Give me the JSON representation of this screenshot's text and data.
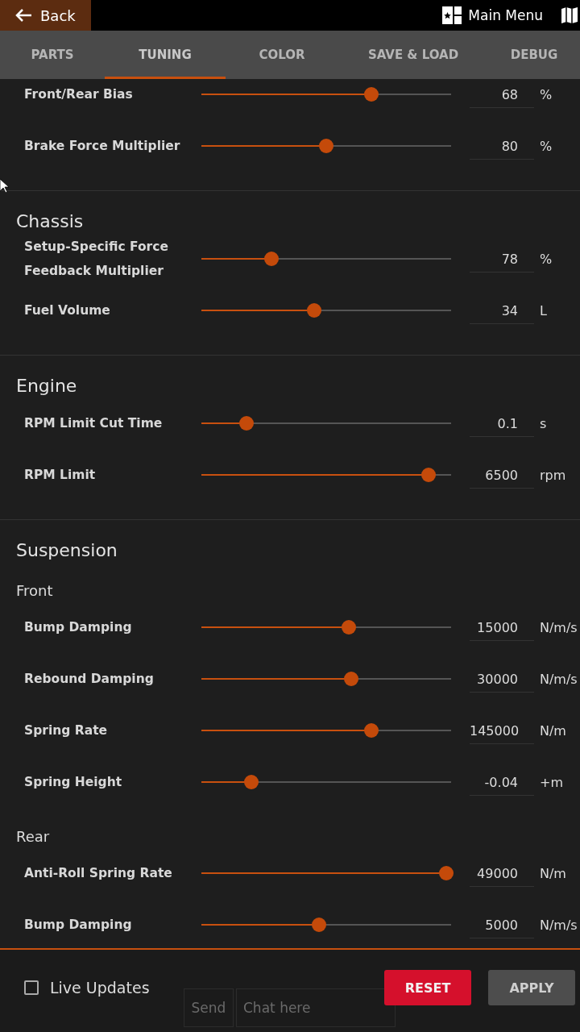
{
  "top_bar": {
    "back_label": "Back",
    "main_menu_label": "Main Menu"
  },
  "tabs": [
    {
      "label": "PARTS",
      "selected": false
    },
    {
      "label": "TUNING",
      "selected": true
    },
    {
      "label": "COLOR",
      "selected": false
    },
    {
      "label": "SAVE & LOAD",
      "selected": false
    },
    {
      "label": "DEBUG",
      "selected": false
    }
  ],
  "sections": [
    {
      "groups": [
        {
          "rows": [
            {
              "label": "Front/Rear Bias",
              "level": 0.68,
              "value": "68",
              "unit": "%"
            },
            {
              "label": "Brake Force Multiplier",
              "level": 0.5,
              "value": "80",
              "unit": "%"
            }
          ]
        }
      ]
    },
    {
      "title": "Chassis",
      "groups": [
        {
          "rows": [
            {
              "label": "Setup-Specific Force Feedback Multiplier",
              "level": 0.28,
              "value": "78",
              "unit": "%"
            },
            {
              "label": "Fuel Volume",
              "level": 0.45,
              "value": "34",
              "unit": "L"
            }
          ]
        }
      ]
    },
    {
      "title": "Engine",
      "groups": [
        {
          "rows": [
            {
              "label": "RPM Limit Cut Time",
              "level": 0.18,
              "value": "0.1",
              "unit": "s"
            },
            {
              "label": "RPM Limit",
              "level": 0.91,
              "value": "6500",
              "unit": "rpm"
            }
          ]
        }
      ]
    },
    {
      "title": "Suspension",
      "groups": [
        {
          "title": "Front",
          "rows": [
            {
              "label": "Bump Damping",
              "level": 0.59,
              "value": "15000",
              "unit": "N/m/s"
            },
            {
              "label": "Rebound Damping",
              "level": 0.6,
              "value": "30000",
              "unit": "N/m/s"
            },
            {
              "label": "Spring Rate",
              "level": 0.68,
              "value": "145000",
              "unit": "N/m"
            },
            {
              "label": "Spring Height",
              "level": 0.2,
              "value": "-0.04",
              "unit": "+m"
            }
          ]
        },
        {
          "title": "Rear",
          "rows": [
            {
              "label": "Anti-Roll Spring Rate",
              "level": 0.98,
              "value": "49000",
              "unit": "N/m"
            },
            {
              "label": "Bump Damping",
              "level": 0.47,
              "value": "5000",
              "unit": "N/m/s"
            }
          ]
        }
      ]
    }
  ],
  "bottom_bar": {
    "live_updates": {
      "label": "Live Updates",
      "checked": false
    },
    "buttons": [
      {
        "label": "RESET",
        "kind": "danger"
      },
      {
        "label": "APPLY",
        "kind": "normal"
      }
    ]
  },
  "chat": {
    "send_label": "Send",
    "placeholder": "Chat here"
  }
}
